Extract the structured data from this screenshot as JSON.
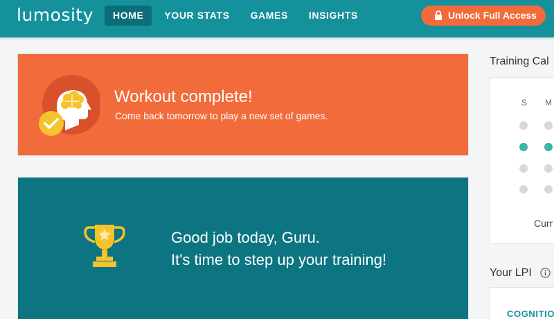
{
  "header": {
    "logo": "lumosity",
    "nav": [
      {
        "label": "HOME",
        "active": true
      },
      {
        "label": "YOUR STATS",
        "active": false
      },
      {
        "label": "GAMES",
        "active": false
      },
      {
        "label": "INSIGHTS",
        "active": false
      }
    ],
    "unlock_label": "Unlock Full Access"
  },
  "workout": {
    "title": "Workout complete!",
    "subtitle": "Come back tomorrow to play a new set of games."
  },
  "goodjob": {
    "line1": "Good job today, Guru.",
    "line2": "It's time to step up your training!"
  },
  "calendar": {
    "heading": "Training Cal",
    "days": [
      "S",
      "M"
    ],
    "current": "Curr"
  },
  "lpi": {
    "heading": "Your LPI",
    "category": "COGNITION"
  },
  "colors": {
    "brand_teal": "#14919b",
    "nav_active": "#0d6e7a",
    "accent_orange": "#f26b3a",
    "card_teal": "#0c7581",
    "trophy_gold": "#f5c42c",
    "dot_done": "#3fb4b0"
  },
  "icons": [
    "lock-icon",
    "brain-head-icon",
    "checkmark-icon",
    "trophy-icon",
    "info-icon"
  ]
}
